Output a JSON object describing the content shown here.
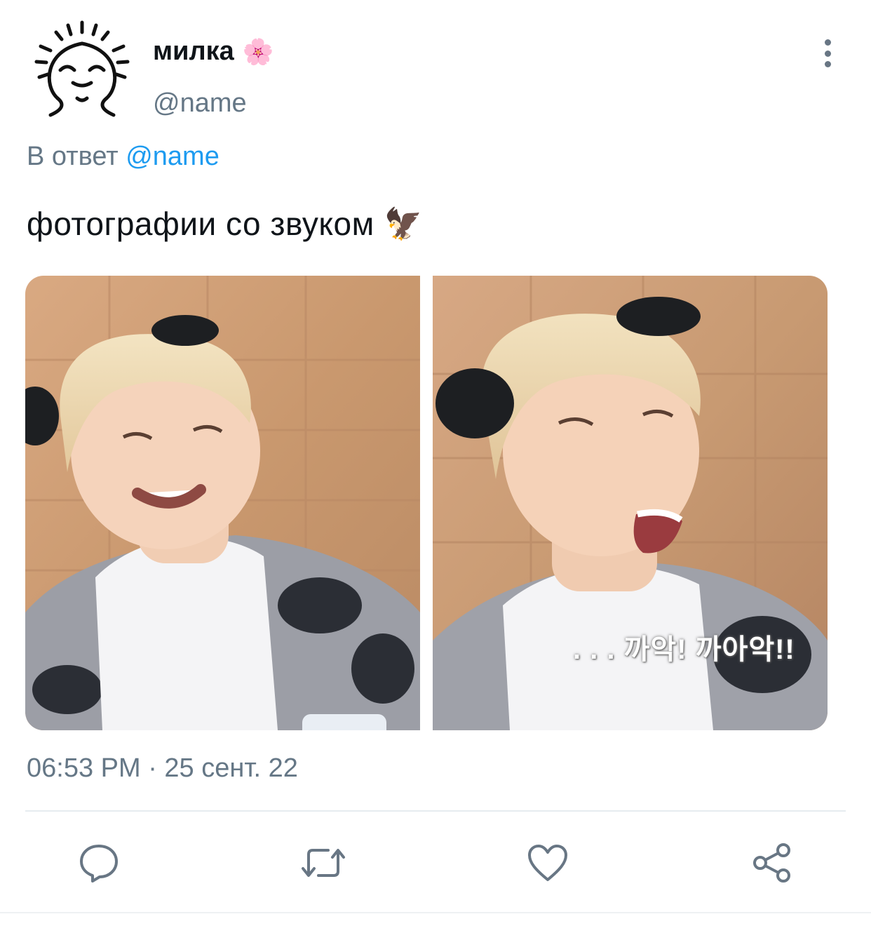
{
  "tweet": {
    "author_name": "милка",
    "author_emoji": "🌸",
    "handle": "@name",
    "reply_prefix": "В ответ",
    "reply_mention": "@name",
    "text": "фотографии со звуком",
    "text_emoji": "🦅",
    "photo2_subtitle": ". . . 까악! 까아악!!",
    "timestamp": "06:53 PM · 25 сент. 22"
  },
  "actions": {
    "reply_icon": "speech-bubble-icon",
    "retweet_icon": "retweet-arrows-icon",
    "like_icon": "heart-outline-icon",
    "share_icon": "share-nodes-icon"
  },
  "colors": {
    "secondary_text": "#657786",
    "link": "#1d9bf0",
    "icon": "#687684"
  }
}
